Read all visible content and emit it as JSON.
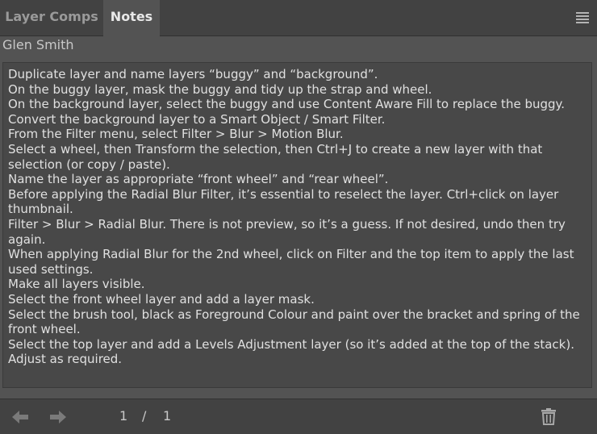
{
  "tabs": [
    {
      "label": "Layer Comps",
      "active": false
    },
    {
      "label": "Notes",
      "active": true
    }
  ],
  "author": "Glen Smith",
  "notes": [
    "Duplicate layer and name layers “buggy” and “background”.",
    "On the buggy layer, mask the buggy and tidy up the strap and wheel.",
    "On the background layer, select the buggy and use Content Aware Fill to replace the buggy.",
    "Convert the background layer to a Smart Object / Smart Filter.",
    "From the Filter menu, select Filter > Blur > Motion Blur.",
    "Select a wheel, then Transform the selection, then Ctrl+J to create a new layer with that selection (or copy / paste).",
    "Name the layer as appropriate “front wheel” and “rear wheel”.",
    "Before applying the Radial Blur Filter, it’s essential to reselect the layer. Ctrl+click on layer thumbnail.",
    "Filter > Blur > Radial Blur. There is not preview, so it’s a guess. If not desired, undo then try again.",
    "When applying Radial Blur for the 2nd wheel, click on Filter and the top item to apply the last used settings.",
    "Make all layers visible.",
    "Select the front wheel layer and add a layer mask.",
    "Select the brush tool, black as Foreground Colour and paint over the bracket and spring of the front wheel.",
    "Select the top layer and add a Levels Adjustment layer (so it’s added at the top of the stack).",
    "Adjust as required."
  ],
  "pager": {
    "current": "1",
    "separator": "/",
    "total": "1"
  },
  "icons": {
    "menu": "hamburger-menu-icon",
    "prev": "arrow-left-icon",
    "next": "arrow-right-icon",
    "delete": "trash-icon"
  },
  "colors": {
    "panel": "#535353",
    "tabbar": "#424242",
    "text": "#e0e0e0"
  }
}
